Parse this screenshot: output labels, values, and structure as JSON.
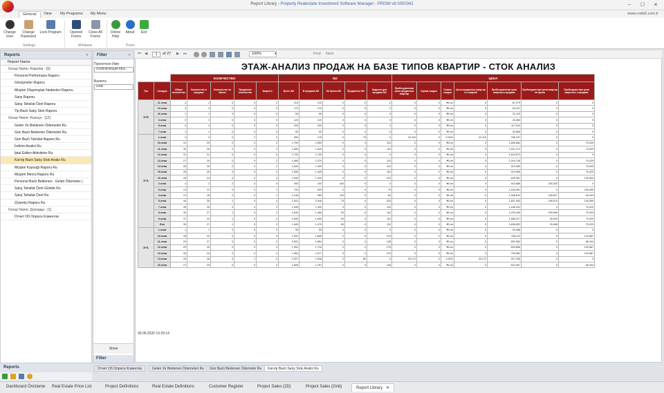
{
  "window": {
    "title_prefix": "Report Library",
    "title_sep": " - ",
    "title_suffix": "Property Realestate Investment Software Manager - PRISM v8.0000341",
    "min": "–",
    "max": "☐",
    "close": "✕"
  },
  "menu_tabs": [
    "General",
    "View",
    "My Programs",
    "My Menu"
  ],
  "site": "www.code5.com.tr",
  "ribbon": {
    "buttons": [
      "Change User",
      "Change Password",
      "Lock Program",
      "Opened Forms",
      "Close All Forms",
      "Online Help",
      "About",
      "Exit"
    ],
    "groups": {
      "settings": "Settings",
      "windows": "Windows",
      "prism": "Prism"
    }
  },
  "reports_panel": {
    "title": "Reports",
    "collapse": "‹",
    "column": "Report Name",
    "items": [
      {
        "t": "Group Name: Raporlar  - [6]",
        "g": true
      },
      {
        "t": "Personel Performans Raporu"
      },
      {
        "t": "Görüşmeler Raporu"
      },
      {
        "t": "Müşteri Oluşmuşluk Nedenleri Raporu"
      },
      {
        "t": "Satış Raporu"
      },
      {
        "t": "Satış Tahsilat Özet Raporu"
      },
      {
        "t": "Tip Bazlı Satış Stok Raporu"
      },
      {
        "t": "Group Name: Russça  - [12]",
        "g": true
      },
      {
        "t": "Gelen Ve Beklenen Ödemeleri Ru"
      },
      {
        "t": "Gün Bazlı Beklenen Ödemeler Ru"
      },
      {
        "t": "Gün Bazlı Tahsilat Raporu Ru"
      },
      {
        "t": "İndirim Analizi Ru"
      },
      {
        "t": "İptal Edilen Aktiviteler Ru"
      },
      {
        "t": "Kat-tip Bazlı Satış Stok Analiz Ru",
        "sel": true
      },
      {
        "t": "Müşteri Kaynağı Raporu Ru"
      },
      {
        "t": "Müşteri Mecra Raporu Ru"
      },
      {
        "t": "Personel Bazlı Beklenen - Gelen Ödemeler ("
      },
      {
        "t": "Satış Tahsilat Özet Günlük Ru"
      },
      {
        "t": "Satış Tahsilat Özet Ru"
      },
      {
        "t": "Ziyaretçi Raporu Ru"
      },
      {
        "t": "Group Name: Доклады  - [1]",
        "g": true
      },
      {
        "t": "Отчет Об Опросе Клиентов"
      }
    ],
    "footer": "Reports"
  },
  "filter_panel": {
    "title": "Filter",
    "collapse": "‹",
    "project_label": "Проектное Имя",
    "project_value": "СОЛНЕЧНЫЙ РЕЗ...",
    "currency_label": "Валюта",
    "currency_value": "USD",
    "show": "Show",
    "footer": "Filter"
  },
  "viewer_toolbar": {
    "page_of": "of 27",
    "page": "1",
    "zoom": "100%",
    "find": "Find",
    "next": "Next"
  },
  "report": {
    "title": "ЭТАЖ-АНАЛИЗ ПРОДАЖ НА БАЗЕ ТИПОВ КВАРТИР - СТОК АНАЛИЗ",
    "group_headers": {
      "qty": "КОЛИЧЕСТВО",
      "m2": "M2",
      "price": "ЦЕНА"
    },
    "columns": [
      "Тип",
      "Складно",
      "Общее количество",
      "Количество в продаже",
      "Количество на брони",
      "Проданное количество",
      "Закрыто",
      "Всего M2",
      "В продаже M2",
      "На брони M2",
      "Проданные M2",
      "Закрыто для продажи M2",
      "Прейскурантная цена проданных квартир",
      "Сумма скидки",
      "Ставка скидки",
      "Цена проданных квартир со скидкой",
      "Прейскурантная цена квартир в продаже",
      "Прейскурантная цена квартир на брони",
      "Прейскурантная цена закрытых к продаже"
    ],
    "groups": [
      {
        "type": "1+0",
        "rows": [
          [
            "11.этаж",
            "4",
            "4",
            "0",
            "0",
            "0",
            "215",
            "215",
            "0",
            "0",
            "0",
            "0",
            "0",
            "₴0,mr",
            "0",
            "87,279",
            "0",
            "0"
          ],
          [
            "13.этаж",
            "3",
            "3",
            "0",
            "0",
            "0",
            "170",
            "170",
            "0",
            "0",
            "0",
            "0",
            "0",
            "₴0,mr",
            "0",
            "54,107",
            "0",
            "0"
          ],
          [
            "16.этаж",
            "1",
            "1",
            "0",
            "0",
            "0",
            "55",
            "55",
            "0",
            "0",
            "0",
            "0",
            "0",
            "₴0,mr",
            "0",
            "22,115",
            "0",
            "0"
          ],
          [
            "3.этаж",
            "2",
            "2",
            "0",
            "0",
            "0",
            "120",
            "120",
            "0",
            "0",
            "0",
            "0",
            "0",
            "₴0,mr",
            "0",
            "43,460",
            "0",
            "0"
          ],
          [
            "5.этаж",
            "4",
            "4",
            "0",
            "0",
            "0",
            "200",
            "200",
            "0",
            "0",
            "0",
            "0",
            "0",
            "₴0,mr",
            "0",
            "117,944",
            "0",
            "0"
          ],
          [
            "7.этаж",
            "1",
            "1",
            "0",
            "0",
            "0",
            "50",
            "50",
            "0",
            "0",
            "0",
            "0",
            "0",
            "₴0,mr",
            "0",
            "30,658",
            "0",
            "0"
          ]
        ]
      },
      {
        "type": "1+1",
        "rows": [
          [
            "1.этаж",
            "4",
            "3",
            "0",
            "1",
            "0",
            "250",
            "175",
            "0",
            "75",
            "0",
            "22,115",
            "0",
            "0.00%",
            "22,115",
            "756,197",
            "0",
            "0"
          ],
          [
            "10.этаж",
            "31",
            "29",
            "0",
            "0",
            "2",
            "1,700",
            "1,590",
            "0",
            "0",
            "110",
            "0",
            "0",
            "₴0,mr",
            "0",
            "1,606,684",
            "0",
            "70,029"
          ],
          [
            "11.этаж",
            "30",
            "28",
            "0",
            "0",
            "2",
            "1,650",
            "1,540",
            "0",
            "0",
            "110",
            "0",
            "0",
            "₴0,mr",
            "0",
            "1,521,472",
            "0",
            "70,029"
          ],
          [
            "12.этаж",
            "31",
            "31",
            "0",
            "0",
            "0",
            "1,700",
            "1,700",
            "0",
            "0",
            "0",
            "0",
            "0",
            "₴0,mr",
            "0",
            "1,624,673",
            "0",
            "0"
          ],
          [
            "13.этаж",
            "27",
            "25",
            "0",
            "0",
            "2",
            "1,480",
            "1,370",
            "0",
            "0",
            "110",
            "0",
            "0",
            "₴0,mr",
            "0",
            "1,419,746",
            "0",
            "70,029"
          ],
          [
            "14.этаж",
            "28",
            "26",
            "0",
            "0",
            "2",
            "1,540",
            "1,430",
            "0",
            "0",
            "110",
            "0",
            "0",
            "₴0,mr",
            "0",
            "910,380",
            "0",
            "70,029"
          ],
          [
            "15.этаж",
            "28",
            "26",
            "0",
            "0",
            "2",
            "1,555",
            "1,445",
            "0",
            "0",
            "110",
            "0",
            "0",
            "₴0,mr",
            "0",
            "913,069",
            "0",
            "70,029"
          ],
          [
            "16.этаж",
            "28",
            "24",
            "0",
            "0",
            "4",
            "1,540",
            "1,320",
            "0",
            "0",
            "220",
            "0",
            "0",
            "₴0,mr",
            "0",
            "840,351",
            "0",
            "140,059"
          ],
          [
            "2.этаж",
            "4",
            "2",
            "2",
            "0",
            "0",
            "250",
            "100",
            "150",
            "0",
            "0",
            "0",
            "0",
            "₴0,mr",
            "0",
            "915,558",
            "304,335",
            "0"
          ],
          [
            "3.этаж",
            "13",
            "12",
            "0",
            "0",
            "1",
            "700",
            "625",
            "0",
            "0",
            "75",
            "0",
            "0",
            "₴0,mr",
            "0",
            "1,163,901",
            "0",
            "126,259"
          ],
          [
            "4.этаж",
            "21",
            "18",
            "2",
            "0",
            "1",
            "1,136",
            "960",
            "120",
            "0",
            "60",
            "0",
            "0",
            "₴0,mr",
            "0",
            "1,308,634",
            "239,817",
            "40,043"
          ],
          [
            "5.этаж",
            "40",
            "35",
            "1",
            "0",
            "4",
            "2,341",
            "2,046",
            "75",
            "0",
            "220",
            "0",
            "0",
            "₴0,mr",
            "0",
            "1,821,053",
            "169,074",
            "140,059"
          ],
          [
            "7.этаж",
            "28",
            "26",
            "0",
            "0",
            "2",
            "1,540",
            "1,430",
            "0",
            "0",
            "110",
            "0",
            "0",
            "₴0,mr",
            "0",
            "1,448,232",
            "0",
            "70,029"
          ],
          [
            "8.этаж",
            "30",
            "27",
            "1",
            "0",
            "2",
            "1,640",
            "1,480",
            "50",
            "0",
            "110",
            "0",
            "0",
            "₴0,mr",
            "0",
            "1,220,349",
            "209,969",
            "70,029"
          ],
          [
            "9.этаж",
            "37",
            "34",
            "1",
            "0",
            "2",
            "2,050",
            "1,900",
            "50",
            "0",
            "110",
            "0",
            "0",
            "₴0,mr",
            "0",
            "1,565,217",
            "40,543",
            "70,029"
          ],
          [
            "Roo",
            "30",
            "27",
            "1",
            "0",
            "2",
            "1,640",
            "1,470",
            "60",
            "0",
            "110",
            "0",
            "0",
            "₴0,mr",
            "0",
            "1,606,832",
            "29,468",
            "70,029"
          ]
        ]
      },
      {
        "type": "2+1",
        "rows": [
          [
            "1.этаж",
            "1",
            "1",
            "0",
            "0",
            "0",
            "59",
            "59",
            "0",
            "0",
            "0",
            "0",
            "0",
            "₴0,mr",
            "0",
            "29,468",
            "0",
            "0"
          ],
          [
            "10.этаж",
            "28",
            "24",
            "0",
            "0",
            "4",
            "1,932",
            "1,656",
            "0",
            "0",
            "276",
            "0",
            "0",
            "₴0,mr",
            "0",
            "796,122",
            "0",
            "132,687"
          ],
          [
            "11.этаж",
            "29",
            "27",
            "0",
            "0",
            "2",
            "2,002",
            "1,864",
            "0",
            "0",
            "138",
            "0",
            "0",
            "₴0,mr",
            "0",
            "891,952",
            "0",
            "66,344"
          ],
          [
            "12.этаж",
            "29",
            "25",
            "0",
            "0",
            "4",
            "1,992",
            "1,716",
            "0",
            "0",
            "276",
            "0",
            "0",
            "₴0,mr",
            "0",
            "825,806",
            "0",
            "132,687"
          ],
          [
            "13.этаж",
            "28",
            "24",
            "0",
            "0",
            "4",
            "1,953",
            "1,677",
            "0",
            "0",
            "276",
            "0",
            "0",
            "₴0,mr",
            "0",
            "790,962",
            "0",
            "132,687"
          ],
          [
            "14.этаж",
            "29",
            "28",
            "0",
            "1",
            "0",
            "2,007",
            "1,938",
            "0",
            "69",
            "0",
            "33,172",
            "0",
            "0.00%",
            "33,172",
            "927,335",
            "0",
            "0"
          ],
          [
            "15.этаж",
            "27",
            "25",
            "0",
            "0",
            "2",
            "1,895",
            "1,757",
            "0",
            "0",
            "138",
            "0",
            "0",
            "₴0,mr",
            "0",
            "823,397",
            "0",
            "66,344"
          ]
        ]
      }
    ],
    "timestamp": "09.06.2020 10:29:14"
  },
  "doc_tabs": [
    "Отчет Об Опросе Клиентов",
    "Gelen Ve Beklenen Ödemeleri Ru",
    "Gün Bazlı Beklenen Ödemeler Ru",
    "Kat-tip Bazlı Satış Stok Analiz Ru"
  ],
  "bottom_tabs": [
    "Dashboard Önizleme",
    "Real Estate Price List",
    "Project Definitions",
    "Real Estate Definitions",
    "Customer Register",
    "Project Sales (2D)",
    "Project Sales (Grid)",
    "Report Library"
  ],
  "bottom_close": "✕",
  "colors": {
    "header_red": "#9b1b1b",
    "selected_row": "#fbe9b4",
    "panel_header": "#dfe4ea"
  }
}
